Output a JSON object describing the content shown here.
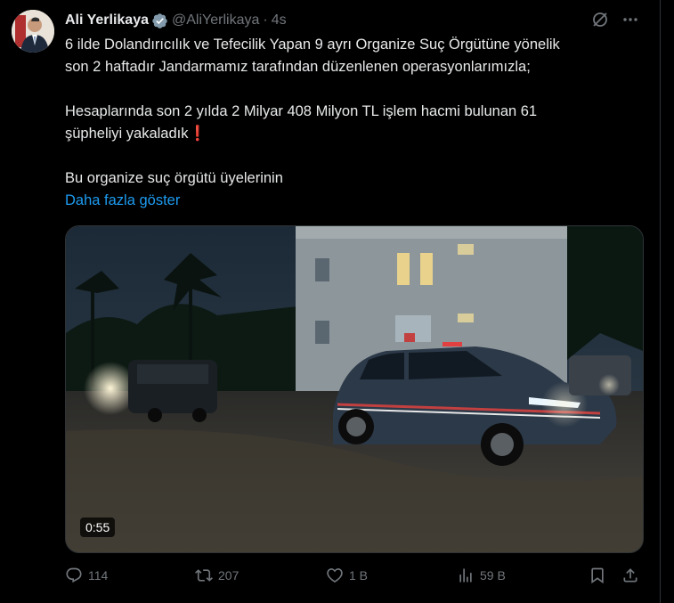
{
  "tweet": {
    "author_name": "Ali Yerlikaya",
    "author_handle": "@AliYerlikaya",
    "separator": "·",
    "timestamp": "4s",
    "text_lines": [
      "6 ilde Dolandırıcılık ve Tefecilik Yapan 9 ayrı Organize Suç Örgütüne yönelik",
      "son 2 haftadır Jandarmamız tarafından düzenlenen operasyonlarımızla;",
      "Hesaplarında son 2 yılda 2 Milyar 408 Milyon TL işlem hacmi bulunan 61",
      "şüpheliyi yakaladık",
      "❗",
      "Bu organize suç örgütü üyelerinin"
    ],
    "show_more": "Daha fazla göster",
    "video_duration": "0:55"
  },
  "actions": {
    "replies": "114",
    "reposts": "207",
    "likes": "1 B",
    "views": "59 B"
  },
  "colors": {
    "background": "#000000",
    "text": "#e7e9ea",
    "muted": "#71767b",
    "link": "#1d9bf0",
    "verified": "#829aab"
  },
  "icons": [
    "verified-badge-icon",
    "grok-icon",
    "more-icon",
    "reply-icon",
    "repost-icon",
    "like-icon",
    "views-icon",
    "bookmark-icon",
    "share-icon"
  ]
}
